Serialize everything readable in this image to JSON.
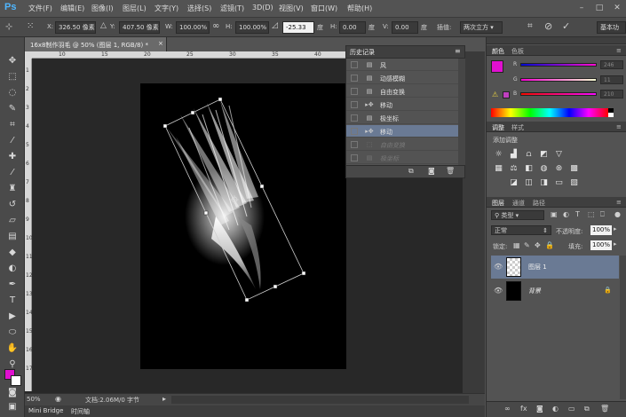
{
  "app": {
    "logo": "Ps"
  },
  "menu": {
    "items": [
      "文件(F)",
      "编辑(E)",
      "图像(I)",
      "图层(L)",
      "文字(Y)",
      "选择(S)",
      "滤镜(T)",
      "3D(D)",
      "视图(V)",
      "窗口(W)",
      "帮助(H)"
    ]
  },
  "options": {
    "x_label": "X:",
    "x_value": "326.50 像素",
    "y_label": "Y:",
    "y_value": "407.50 像素",
    "w_label": "W:",
    "w_value": "100.00%",
    "h_label": "H:",
    "h_value": "100.00%",
    "angle_value": "-25.33",
    "angle_unit": "度",
    "hskew_label": "H:",
    "hskew_value": "0.00",
    "hskew_unit": "度",
    "vskew_label": "V:",
    "vskew_value": "0.00",
    "vskew_unit": "度",
    "interp_label": "插值:",
    "interp_value": "两次立方",
    "workspace": "基本功"
  },
  "document": {
    "tab_title": "16x8制作羽毛 @ 50% (图层 1, RGB/8) *",
    "ruler_top": [
      "10",
      "15",
      "20",
      "25",
      "30",
      "35",
      "40",
      "45",
      "50",
      "55"
    ],
    "ruler_left": [
      "1",
      "2",
      "3",
      "4",
      "5",
      "6",
      "7",
      "8",
      "9",
      "10",
      "11",
      "12",
      "13",
      "14",
      "15",
      "16",
      "17"
    ]
  },
  "status": {
    "zoom": "50%",
    "doc_info": "文档:2.06M/0 字节"
  },
  "bottom_tabs": {
    "mini_bridge": "Mini Bridge",
    "timeline": "时间轴"
  },
  "history": {
    "title": "历史记录",
    "items": [
      {
        "label": "风",
        "state": "normal"
      },
      {
        "label": "动感模糊",
        "state": "normal"
      },
      {
        "label": "自由变换",
        "state": "normal"
      },
      {
        "label": "移动",
        "state": "normal"
      },
      {
        "label": "极坐标",
        "state": "normal"
      },
      {
        "label": "移动",
        "state": "selected"
      },
      {
        "label": "自由变换",
        "state": "dim"
      },
      {
        "label": "极坐标",
        "state": "dim"
      }
    ]
  },
  "color_panel": {
    "tabs": [
      "颜色",
      "色板"
    ],
    "r_label": "R",
    "g_label": "G",
    "b_label": "B",
    "r_value": "246",
    "g_value": "11",
    "b_value": "210",
    "foreground": "#e010d0",
    "background": "#ffffff"
  },
  "adjustments_panel": {
    "tabs": [
      "调整",
      "样式"
    ],
    "add_label": "添加调整"
  },
  "layers_panel": {
    "tabs": [
      "图层",
      "通道",
      "路径"
    ],
    "filter_label": "类型",
    "blend_mode": "正常",
    "opacity_label": "不透明度:",
    "opacity_value": "100%",
    "lock_label": "锁定:",
    "fill_label": "填充:",
    "fill_value": "100%",
    "layers": [
      {
        "name": "图层 1",
        "selected": true
      },
      {
        "name": "背景",
        "selected": false
      }
    ]
  }
}
